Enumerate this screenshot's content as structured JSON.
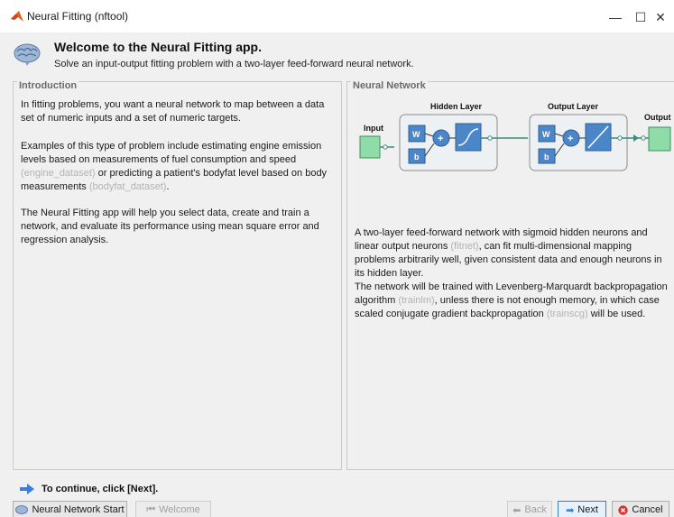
{
  "window": {
    "title": "Neural Fitting (nftool)",
    "controls": {
      "minimize": "—",
      "maximize": "☐",
      "close": "✕"
    }
  },
  "header": {
    "title": "Welcome to the Neural Fitting app.",
    "subtitle": "Solve an input-output fitting problem with a two-layer feed-forward neural network."
  },
  "intro": {
    "legend": "Introduction",
    "p1": "In fitting problems, you want a neural network to map between a data set of numeric inputs and a set of numeric targets.",
    "p2_a": "Examples of this type of problem include estimating engine emission levels based on measurements of fuel consumption and speed",
    "p2_link1": "(engine_dataset)",
    "p2_b": "or predicting a patient's bodyfat level based on body measurements",
    "p2_link2": "(bodyfat_dataset)",
    "p2_c": ".",
    "p3": "The Neural Fitting app will help you select data, create and train a network, and evaluate its performance using mean square error and regression analysis."
  },
  "network": {
    "legend": "Neural Network",
    "diagram": {
      "input_label": "Input",
      "output_label": "Output",
      "hidden_layer_label": "Hidden Layer",
      "output_layer_label": "Output Layer",
      "weight_label": "W",
      "bias_label": "b",
      "sum_symbol": "+"
    },
    "p1_a": "A two-layer feed-forward network with sigmoid hidden neurons and linear output neurons",
    "p1_link": "(fitnet)",
    "p1_b": ", can fit multi-dimensional mapping problems arbitrarily well, given consistent data and enough neurons in its hidden layer.",
    "p2_a": "The network will be trained with Levenberg-Marquardt backpropagation algorithm",
    "p2_link1": "(trainlm)",
    "p2_b": ", unless there is not enough memory, in which case scaled conjugate gradient backpropagation",
    "p2_link2": "(trainscg)",
    "p2_c": "will be used."
  },
  "footer": {
    "hint": "To continue, click [Next].",
    "nn_start": "Neural Network Start",
    "welcome": "Welcome",
    "back": "Back",
    "next": "Next",
    "cancel": "Cancel"
  },
  "colors": {
    "accent_blue": "#3b7dd8",
    "input_green": "#8fdca8",
    "layer_blue": "#4a86c8",
    "cancel_red": "#d9312b"
  }
}
